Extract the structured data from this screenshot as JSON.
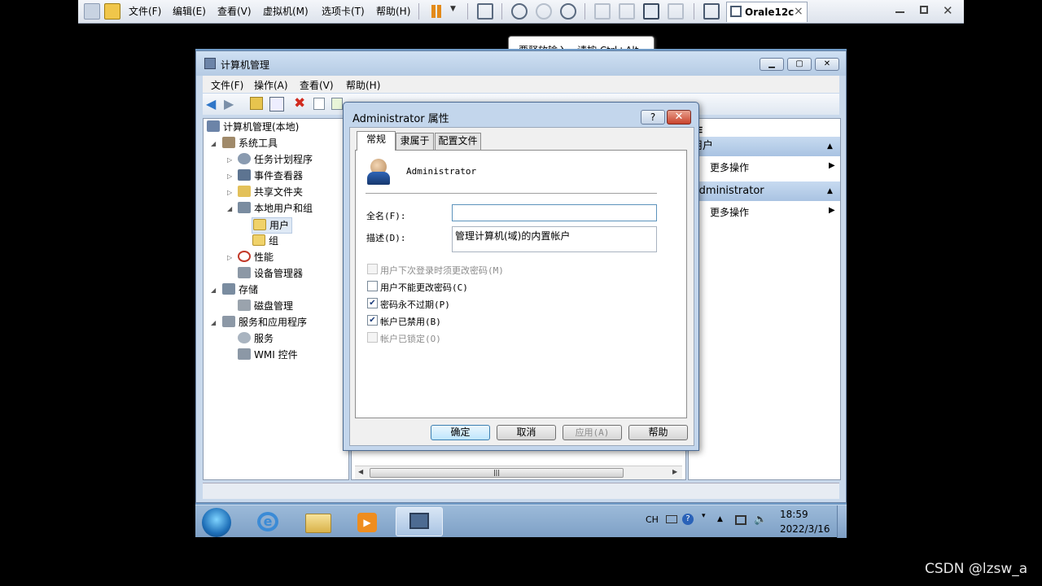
{
  "vmware": {
    "menu": [
      "文件(F)",
      "编辑(E)",
      "查看(V)",
      "虚拟机(M)",
      "选项卡(T)",
      "帮助(H)"
    ],
    "tab_label": "Orale12c",
    "tab_close": "×",
    "tooltip": "要释放输入，请按 Ctrl+Alt。"
  },
  "mmc": {
    "title": "计算机管理",
    "menu": [
      "文件(F)",
      "操作(A)",
      "查看(V)",
      "帮助(H)"
    ],
    "tree": {
      "root": "计算机管理(本地)",
      "system_tools": "系统工具",
      "task_scheduler": "任务计划程序",
      "event_viewer": "事件查看器",
      "shared_folders": "共享文件夹",
      "local_users": "本地用户和组",
      "users": "用户",
      "groups": "组",
      "performance": "性能",
      "device_manager": "设备管理器",
      "storage": "存储",
      "disk_management": "磁盘管理",
      "services_apps": "服务和应用程序",
      "services": "服务",
      "wmi": "WMI 控件"
    },
    "actions": {
      "header": "作",
      "section1": "用户",
      "section1_more": "更多操作",
      "section2": "Administrator",
      "section2_more": "更多操作"
    }
  },
  "dialog": {
    "title": "Administrator 属性",
    "help_btn": "?",
    "close_btn": "✕",
    "tabs": [
      "常规",
      "隶属于",
      "配置文件"
    ],
    "username": "Administrator",
    "fullname_label": "全名(F):",
    "fullname_value": "",
    "description_label": "描述(D):",
    "description_value": "管理计算机(域)的内置帐户",
    "checkboxes": [
      {
        "label": "用户下次登录时须更改密码(M)",
        "checked": false,
        "disabled": true
      },
      {
        "label": "用户不能更改密码(C)",
        "checked": false,
        "disabled": false
      },
      {
        "label": "密码永不过期(P)",
        "checked": true,
        "disabled": false
      },
      {
        "label": "帐户已禁用(B)",
        "checked": true,
        "disabled": false
      },
      {
        "label": "帐户已锁定(O)",
        "checked": false,
        "disabled": true
      }
    ],
    "buttons": {
      "ok": "确定",
      "cancel": "取消",
      "apply": "应用(A)",
      "help": "帮助"
    }
  },
  "taskbar": {
    "lang": "CH",
    "time": "18:59",
    "date": "2022/3/16"
  },
  "watermark": "CSDN @lzsw_a"
}
